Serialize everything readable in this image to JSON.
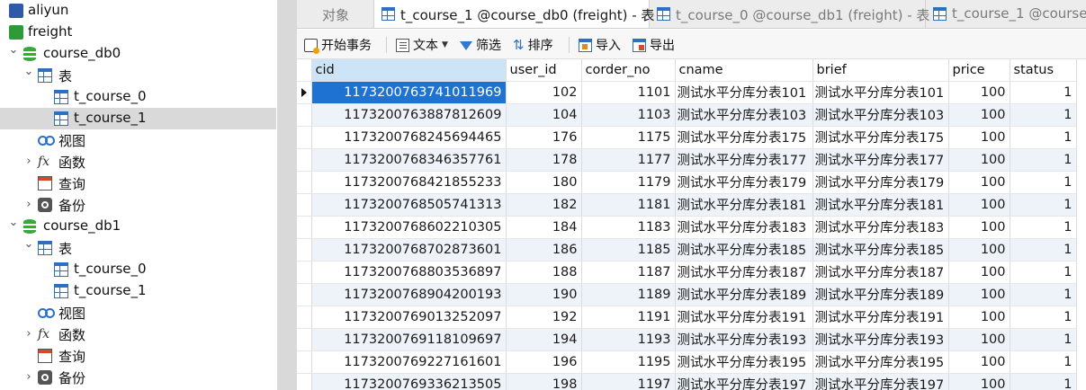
{
  "tree": {
    "items": [
      {
        "label": "aliyun",
        "level": 0,
        "expanded": false,
        "icon": "connection-icon",
        "selected": false
      },
      {
        "label": "freight",
        "level": 0,
        "expanded": true,
        "icon": "connection-icon",
        "selected": false
      },
      {
        "label": "course_db0",
        "level": 1,
        "expanded": true,
        "icon": "database-icon",
        "selected": false
      },
      {
        "label": "表",
        "level": 2,
        "expanded": true,
        "icon": "tables-folder-icon",
        "selected": false
      },
      {
        "label": "t_course_0",
        "level": 3,
        "expanded": null,
        "icon": "table-icon",
        "selected": false
      },
      {
        "label": "t_course_1",
        "level": 3,
        "expanded": null,
        "icon": "table-icon",
        "selected": true
      },
      {
        "label": "视图",
        "level": 2,
        "expanded": null,
        "icon": "view-icon",
        "selected": false
      },
      {
        "label": "函数",
        "level": 2,
        "expanded": false,
        "icon": "function-icon",
        "selected": false
      },
      {
        "label": "查询",
        "level": 2,
        "expanded": null,
        "icon": "query-icon",
        "selected": false
      },
      {
        "label": "备份",
        "level": 2,
        "expanded": false,
        "icon": "backup-icon",
        "selected": false
      },
      {
        "label": "course_db1",
        "level": 1,
        "expanded": true,
        "icon": "database-icon",
        "selected": false
      },
      {
        "label": "表",
        "level": 2,
        "expanded": true,
        "icon": "tables-folder-icon",
        "selected": false
      },
      {
        "label": "t_course_0",
        "level": 3,
        "expanded": null,
        "icon": "table-icon",
        "selected": false
      },
      {
        "label": "t_course_1",
        "level": 3,
        "expanded": null,
        "icon": "table-icon",
        "selected": false
      },
      {
        "label": "视图",
        "level": 2,
        "expanded": null,
        "icon": "view-icon",
        "selected": false
      },
      {
        "label": "函数",
        "level": 2,
        "expanded": false,
        "icon": "function-icon",
        "selected": false
      },
      {
        "label": "查询",
        "level": 2,
        "expanded": null,
        "icon": "query-icon",
        "selected": false
      },
      {
        "label": "备份",
        "level": 2,
        "expanded": false,
        "icon": "backup-icon",
        "selected": false
      }
    ]
  },
  "tabs": [
    {
      "label": "对象",
      "active": false,
      "icon": null
    },
    {
      "label": "t_course_1 @course_db0 (freight) - 表",
      "active": true,
      "icon": "table-icon"
    },
    {
      "label": "t_course_0 @course_db1 (freight) - 表",
      "active": false,
      "icon": "table-icon"
    },
    {
      "label": "t_course_1 @course_",
      "active": false,
      "icon": "table-icon"
    }
  ],
  "toolbar": {
    "begin_transaction": "开始事务",
    "text": "文本",
    "filter": "筛选",
    "sort": "排序",
    "import": "导入",
    "export": "导出"
  },
  "grid": {
    "columns": [
      "cid",
      "user_id",
      "corder_no",
      "cname",
      "brief",
      "price",
      "status"
    ],
    "selected_row": 0,
    "selected_column": "cid",
    "rows": [
      [
        "1173200763741011969",
        "102",
        "1101",
        "测试水平分库分表101",
        "测试水平分库分表101",
        "100",
        "1"
      ],
      [
        "1173200763887812609",
        "104",
        "1103",
        "测试水平分库分表103",
        "测试水平分库分表103",
        "100",
        "1"
      ],
      [
        "1173200768245694465",
        "176",
        "1175",
        "测试水平分库分表175",
        "测试水平分库分表175",
        "100",
        "1"
      ],
      [
        "1173200768346357761",
        "178",
        "1177",
        "测试水平分库分表177",
        "测试水平分库分表177",
        "100",
        "1"
      ],
      [
        "1173200768421855233",
        "180",
        "1179",
        "测试水平分库分表179",
        "测试水平分库分表179",
        "100",
        "1"
      ],
      [
        "1173200768505741313",
        "182",
        "1181",
        "测试水平分库分表181",
        "测试水平分库分表181",
        "100",
        "1"
      ],
      [
        "1173200768602210305",
        "184",
        "1183",
        "测试水平分库分表183",
        "测试水平分库分表183",
        "100",
        "1"
      ],
      [
        "1173200768702873601",
        "186",
        "1185",
        "测试水平分库分表185",
        "测试水平分库分表185",
        "100",
        "1"
      ],
      [
        "1173200768803536897",
        "188",
        "1187",
        "测试水平分库分表187",
        "测试水平分库分表187",
        "100",
        "1"
      ],
      [
        "1173200768904200193",
        "190",
        "1189",
        "测试水平分库分表189",
        "测试水平分库分表189",
        "100",
        "1"
      ],
      [
        "1173200769013252097",
        "192",
        "1191",
        "测试水平分库分表191",
        "测试水平分库分表191",
        "100",
        "1"
      ],
      [
        "1173200769118109697",
        "194",
        "1193",
        "测试水平分库分表193",
        "测试水平分库分表193",
        "100",
        "1"
      ],
      [
        "1173200769227161601",
        "196",
        "1195",
        "测试水平分库分表195",
        "测试水平分库分表195",
        "100",
        "1"
      ],
      [
        "1173200769336213505",
        "198",
        "1197",
        "测试水平分库分表197",
        "测试水平分库分表197",
        "100",
        "1"
      ]
    ]
  },
  "colors": {
    "selection": "#1e73d2",
    "tree_selected": "#d9d9d9",
    "alt_row": "#eef3fa",
    "header_selected": "#cde4f7"
  }
}
